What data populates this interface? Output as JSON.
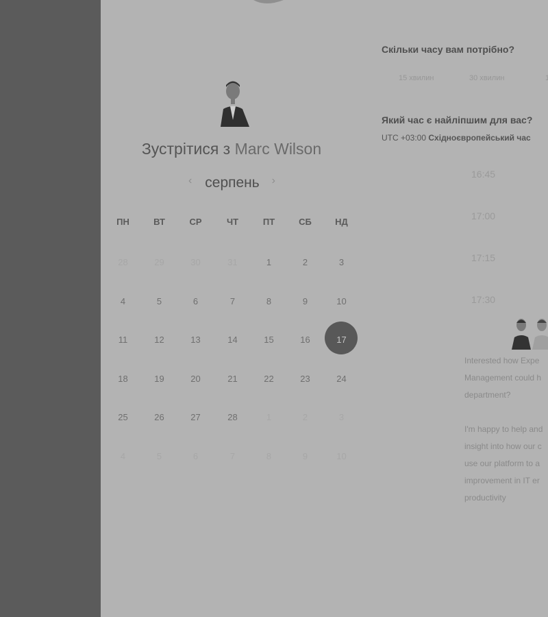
{
  "meeting": {
    "title_prefix": "Зустрітися з",
    "host_name": "Marc Wilson"
  },
  "calendar": {
    "month": "серпень",
    "prev_icon": "chevron-left-icon",
    "next_icon": "chevron-right-icon",
    "weekdays": [
      "ПН",
      "ВТ",
      "СР",
      "ЧТ",
      "ПТ",
      "СБ",
      "НД"
    ],
    "weeks": [
      [
        "28",
        "29",
        "30",
        "31",
        "1",
        "2",
        "3"
      ],
      [
        "4",
        "5",
        "6",
        "7",
        "8",
        "9",
        "10"
      ],
      [
        "11",
        "12",
        "13",
        "14",
        "15",
        "16",
        "17"
      ],
      [
        "18",
        "19",
        "20",
        "21",
        "22",
        "23",
        "24"
      ],
      [
        "25",
        "26",
        "27",
        "28",
        "1",
        "2",
        "3"
      ],
      [
        "4",
        "5",
        "6",
        "7",
        "8",
        "9",
        "10"
      ]
    ],
    "selected_day": "17"
  },
  "duration": {
    "question": "Скільки часу вам потрібно?",
    "options": [
      "15 хвилин",
      "30 хвилин",
      "1"
    ]
  },
  "time": {
    "question": "Який час є найліпшим для вас?",
    "timezone_offset": "UTC +03:00",
    "timezone_name": "Східноєвропейський час",
    "slots": [
      "16:45",
      "17:00",
      "17:15",
      "17:30"
    ]
  },
  "description": {
    "lines": [
      "Interested how Expe",
      "Management could h",
      "department?",
      "",
      "I'm happy to help and",
      "insight into how our c",
      "use our platform to a",
      "improvement in IT er",
      "productivity"
    ]
  },
  "colors": {
    "sidebar": "#5b5b5b",
    "background": "#b3b3b3",
    "selected_day": "#585858"
  }
}
